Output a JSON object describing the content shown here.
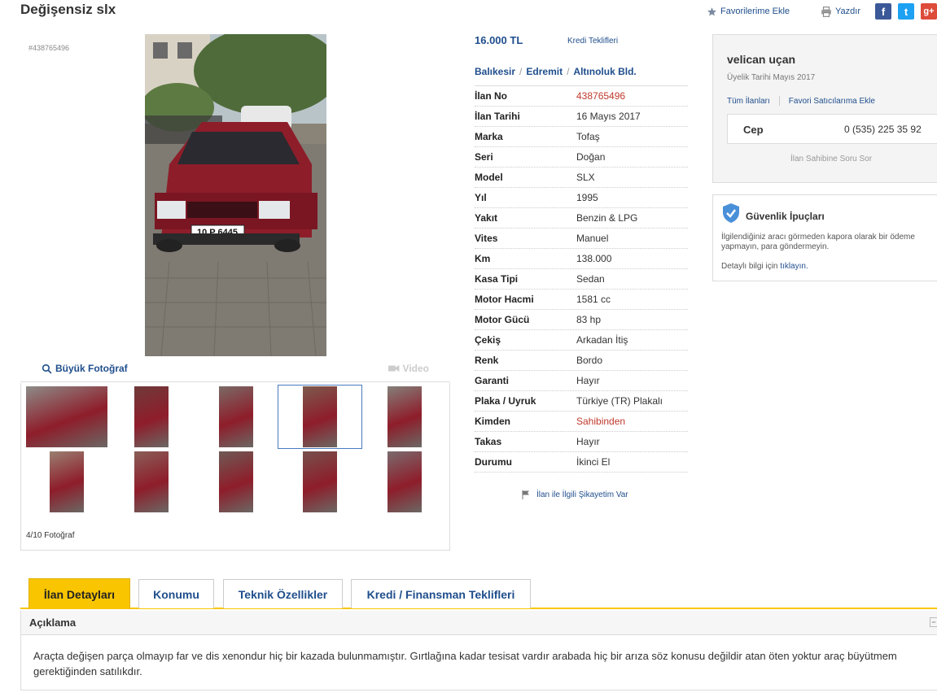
{
  "header": {
    "title": "Değişensiz slx",
    "favorite_label": "Favorilerime Ekle",
    "print_label": "Yazdır",
    "share": {
      "facebook": "f",
      "twitter": "t",
      "google": "g+"
    }
  },
  "gallery": {
    "ad_id": "#438765496",
    "big_photo_label": "Büyük Fotoğraf",
    "video_label": "Video",
    "photo_count": "4/10 Fotoğraf",
    "active_index": 4,
    "thumb_count": 10
  },
  "listing": {
    "price": "16.000 TL",
    "credit_offers": "Kredi Teklifleri",
    "location": [
      "Balıkesir",
      "Edremit",
      "Altınoluk Bld."
    ],
    "details": [
      {
        "key": "İlan No",
        "value": "438765496",
        "highlight": true
      },
      {
        "key": "İlan Tarihi",
        "value": "16 Mayıs 2017"
      },
      {
        "key": "Marka",
        "value": "Tofaş"
      },
      {
        "key": "Seri",
        "value": "Doğan"
      },
      {
        "key": "Model",
        "value": "SLX"
      },
      {
        "key": "Yıl",
        "value": "1995"
      },
      {
        "key": "Yakıt",
        "value": "Benzin & LPG"
      },
      {
        "key": "Vites",
        "value": "Manuel"
      },
      {
        "key": "Km",
        "value": "138.000"
      },
      {
        "key": "Kasa Tipi",
        "value": "Sedan"
      },
      {
        "key": "Motor Hacmi",
        "value": "1581 cc"
      },
      {
        "key": "Motor Gücü",
        "value": "83 hp"
      },
      {
        "key": "Çekiş",
        "value": "Arkadan İtiş"
      },
      {
        "key": "Renk",
        "value": "Bordo"
      },
      {
        "key": "Garanti",
        "value": "Hayır"
      },
      {
        "key": "Plaka / Uyruk",
        "value": "Türkiye (TR) Plakalı"
      },
      {
        "key": "Kimden",
        "value": "Sahibinden",
        "highlight": true
      },
      {
        "key": "Takas",
        "value": "Hayır"
      },
      {
        "key": "Durumu",
        "value": "İkinci El"
      }
    ],
    "complaint": "İlan ile İlgili Şikayetim Var",
    "plate": "10 P 6445"
  },
  "seller": {
    "name": "velican uçan",
    "member_since": "Üyelik Tarihi  Mayıs 2017",
    "all_ads": "Tüm İlanları",
    "add_favorite_seller": "Favori Satıcılarıma Ekle",
    "phone_label": "Cep",
    "phone": "0 (535) 225 35 92",
    "ask": "İlan Sahibine Soru Sor"
  },
  "security": {
    "title": "Güvenlik İpuçları",
    "text": "İlgilendiğiniz aracı görmeden kapora olarak bir ödeme yapmayın, para göndermeyin.",
    "more_prefix": "Detaylı bilgi için ",
    "more_link": "tıklayın."
  },
  "tabs": [
    {
      "label": "İlan Detayları",
      "active": true
    },
    {
      "label": "Konumu"
    },
    {
      "label": "Teknik Özellikler"
    },
    {
      "label": "Kredi / Finansman Teklifleri"
    }
  ],
  "description": {
    "heading": "Açıklama",
    "collapse": "−",
    "text": "Araçta değişen parça olmayıp far ve dis xenondur hiç bir kazada bulunmamıştır. Gırtlağına kadar tesisat vardır arabada hiç bir arıza söz konusu değildir atan öten yoktur araç büyütmem gerektiğinden satılıkdır."
  },
  "colors": {
    "link": "#1f4e8c",
    "accent": "#f9c500",
    "highlight": "#c0392b",
    "car": "#8e1d2a"
  }
}
